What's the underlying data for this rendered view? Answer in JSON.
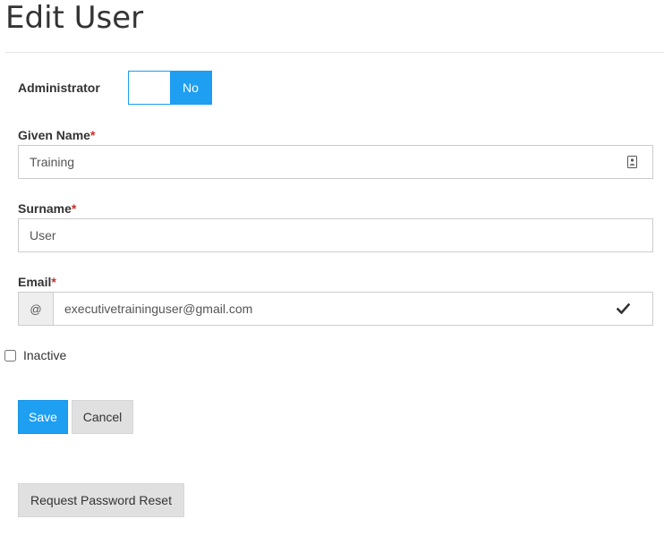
{
  "page": {
    "title": "Edit User"
  },
  "administrator": {
    "label": "Administrator",
    "toggle_value": "No"
  },
  "given_name": {
    "label": "Given Name",
    "required_mark": "*",
    "value": "Training"
  },
  "surname": {
    "label": "Surname",
    "required_mark": "*",
    "value": "User"
  },
  "email": {
    "label": "Email",
    "required_mark": "*",
    "addon": "@",
    "value": "executivetraininguser@gmail.com"
  },
  "inactive": {
    "label": "Inactive",
    "checked": false
  },
  "actions": {
    "save_label": "Save",
    "cancel_label": "Cancel",
    "reset_label": "Request Password Reset"
  },
  "colors": {
    "primary": "#1e9ff2",
    "required": "#c9302c",
    "secondary_button": "#e0e0e0"
  },
  "icons": {
    "given_name_addon": "contact-card-icon",
    "email_status": "checkmark-icon"
  }
}
